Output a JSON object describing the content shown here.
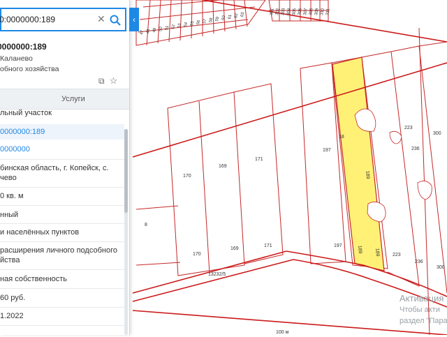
{
  "search": {
    "value": "0:0000000:189",
    "clear_icon": "close-icon",
    "search_icon": "magnifier-icon"
  },
  "card": {
    "title": "0000000:189",
    "location": "Каланево",
    "purpose_short": "обного хозяйства"
  },
  "tabs": {
    "services": "Услуги"
  },
  "info": {
    "type": "льный участок",
    "cad_number": "0000000:189",
    "quarter": "0000000",
    "address_line1": "бинская область, г. Копейск, с.",
    "address_line2": "чево",
    "area": "0 кв. м",
    "status": "нный",
    "category": "и населённых пунктов",
    "use_line1": "расширения личного подсобного",
    "use_line2": "йства",
    "ownership": "ная собственность",
    "value": "60 руб.",
    "date": "1.2022"
  },
  "map": {
    "parcels": {
      "p170a": "170",
      "p169a": "169",
      "p171a": "171",
      "p197a": "197",
      "p18": "18",
      "p223a": "223",
      "p236a": "236",
      "p300a": "300",
      "p8": "8",
      "p170b": "170",
      "p169b": "169",
      "p171b": "171",
      "p197b": "197",
      "p223b": "223",
      "p236b": "236",
      "p300b": "300",
      "p189a": "189",
      "p189b": "189",
      "road": "13232/5",
      "scale": "100 м"
    },
    "top_parcels": [
      "47",
      "48",
      "49",
      "50",
      "51",
      "52",
      "53",
      "54",
      "55",
      "56",
      "57",
      "58",
      "59",
      "60",
      "61",
      "62",
      "63",
      "301",
      "302",
      "303",
      "304",
      "305",
      "306",
      "307",
      "308",
      "309",
      "310",
      "311"
    ],
    "watermark_line1": "Активация",
    "watermark_line2": "Чтобы акти",
    "watermark_line3": "раздел \"Пара"
  },
  "colors": {
    "accent": "#1e88e5",
    "boundary": "#cc1a1a",
    "selected": "#fff176"
  }
}
